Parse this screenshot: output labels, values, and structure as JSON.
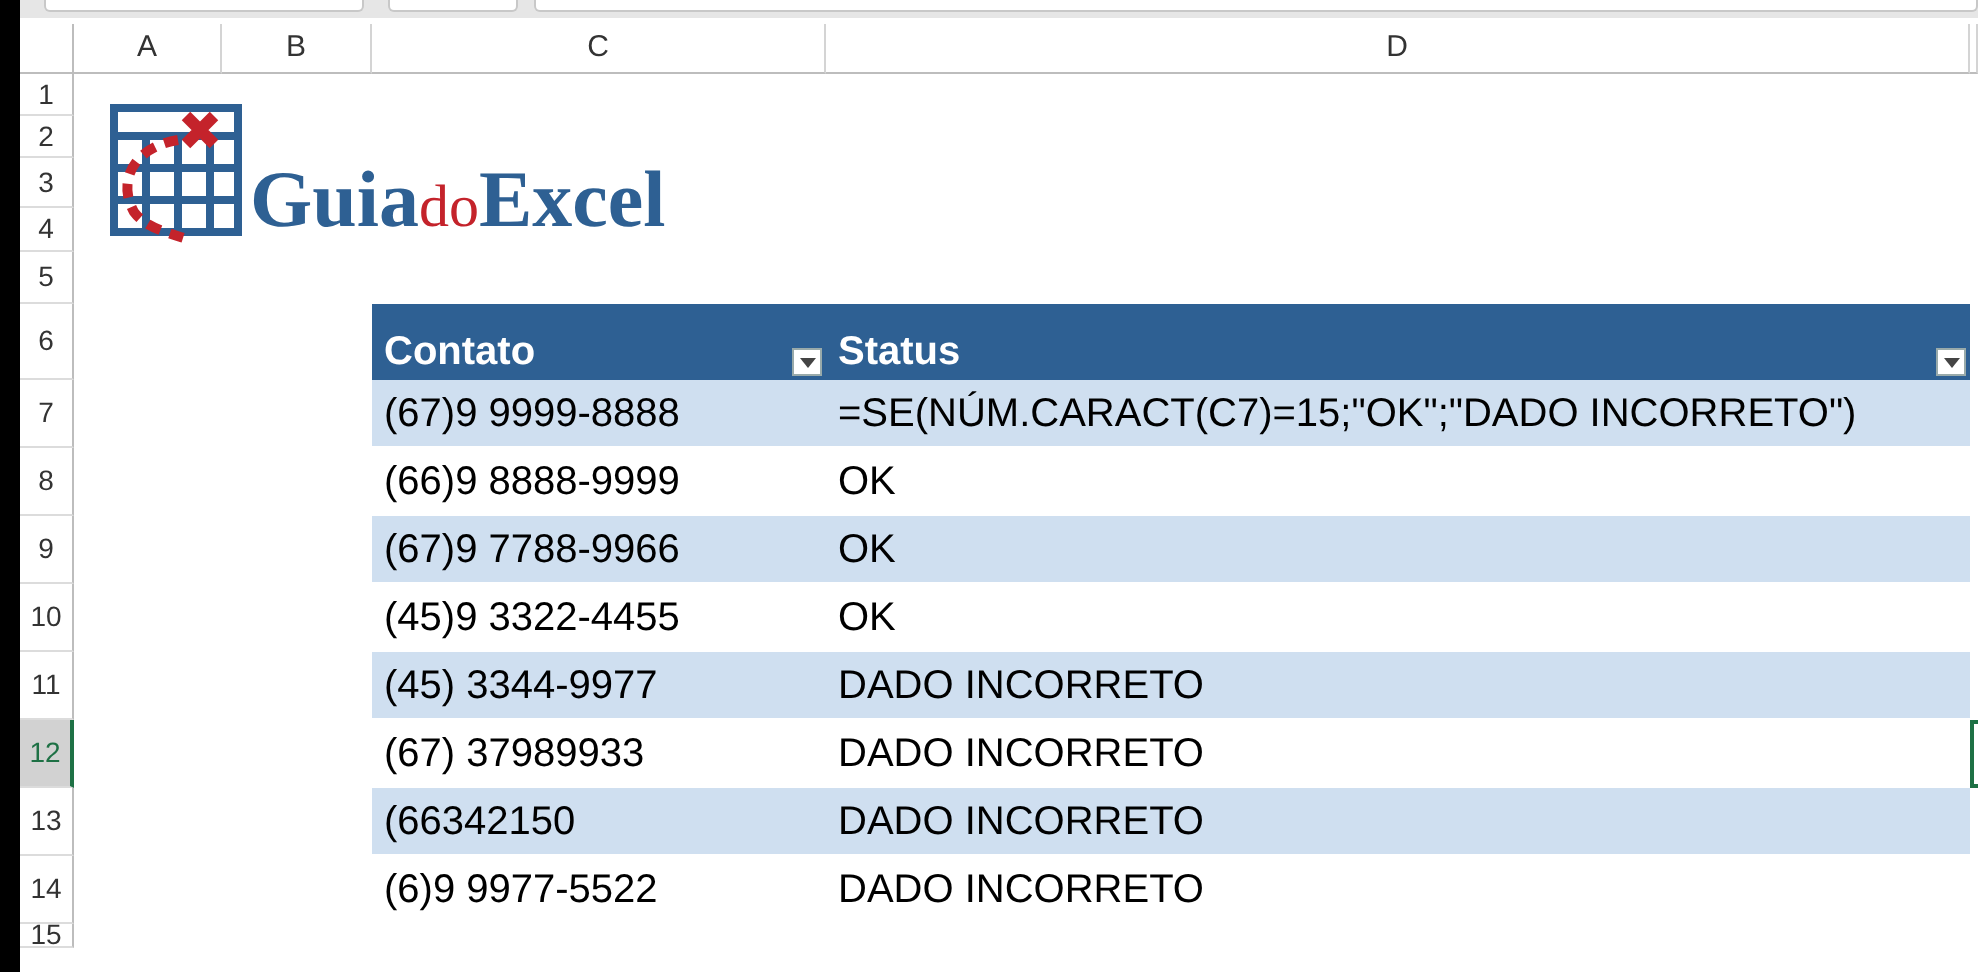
{
  "columns": [
    "A",
    "B",
    "C",
    "D"
  ],
  "row_numbers": [
    {
      "label": "1",
      "selected": false
    },
    {
      "label": "2",
      "selected": false
    },
    {
      "label": "3",
      "selected": false
    },
    {
      "label": "4",
      "selected": false
    },
    {
      "label": "5",
      "selected": false
    },
    {
      "label": "6",
      "selected": false
    },
    {
      "label": "7",
      "selected": false
    },
    {
      "label": "8",
      "selected": false
    },
    {
      "label": "9",
      "selected": false
    },
    {
      "label": "10",
      "selected": false
    },
    {
      "label": "11",
      "selected": false
    },
    {
      "label": "12",
      "selected": true
    },
    {
      "label": "13",
      "selected": false
    },
    {
      "label": "14",
      "selected": false
    },
    {
      "label": "15",
      "selected": false
    }
  ],
  "logo": {
    "parts": [
      {
        "text": "Guia",
        "kind": "main"
      },
      {
        "text": "do",
        "kind": "accent"
      },
      {
        "text": "Excel",
        "kind": "main"
      }
    ]
  },
  "table": {
    "headers": [
      "Contato",
      "Status"
    ],
    "rows": [
      [
        "(67)9 9999-8888",
        "=SE(NÚM.CARACT(C7)=15;\"OK\";\"DADO INCORRETO\")"
      ],
      [
        "(66)9 8888-9999",
        "OK"
      ],
      [
        "(67)9 7788-9966",
        "OK"
      ],
      [
        "(45)9 3322-4455",
        "OK"
      ],
      [
        "(45) 3344-9977",
        "DADO INCORRETO"
      ],
      [
        "(67) 37989933",
        "DADO INCORRETO"
      ],
      [
        "(66342150",
        "DADO INCORRETO"
      ],
      [
        "(6)9 9977-5522",
        "DADO INCORRETO"
      ]
    ]
  }
}
